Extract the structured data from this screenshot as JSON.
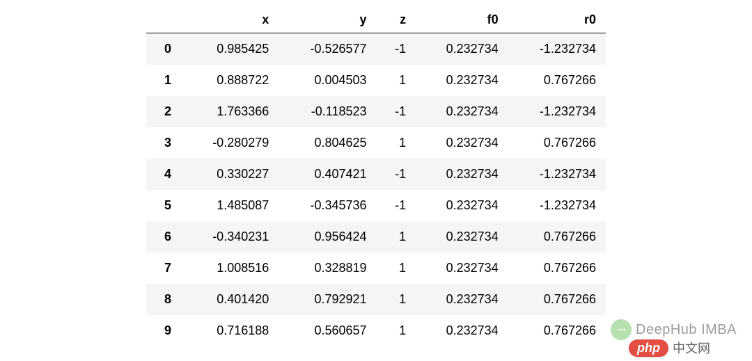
{
  "chart_data": {
    "type": "table",
    "columns": [
      "x",
      "y",
      "z",
      "f0",
      "r0"
    ],
    "index": [
      "0",
      "1",
      "2",
      "3",
      "4",
      "5",
      "6",
      "7",
      "8",
      "9"
    ],
    "rows": [
      {
        "x": "0.985425",
        "y": "-0.526577",
        "z": "-1",
        "f0": "0.232734",
        "r0": "-1.232734"
      },
      {
        "x": "0.888722",
        "y": "0.004503",
        "z": "1",
        "f0": "0.232734",
        "r0": "0.767266"
      },
      {
        "x": "1.763366",
        "y": "-0.118523",
        "z": "-1",
        "f0": "0.232734",
        "r0": "-1.232734"
      },
      {
        "x": "-0.280279",
        "y": "0.804625",
        "z": "1",
        "f0": "0.232734",
        "r0": "0.767266"
      },
      {
        "x": "0.330227",
        "y": "0.407421",
        "z": "-1",
        "f0": "0.232734",
        "r0": "-1.232734"
      },
      {
        "x": "1.485087",
        "y": "-0.345736",
        "z": "-1",
        "f0": "0.232734",
        "r0": "-1.232734"
      },
      {
        "x": "-0.340231",
        "y": "0.956424",
        "z": "1",
        "f0": "0.232734",
        "r0": "0.767266"
      },
      {
        "x": "1.008516",
        "y": "0.328819",
        "z": "1",
        "f0": "0.232734",
        "r0": "0.767266"
      },
      {
        "x": "0.401420",
        "y": "0.792921",
        "z": "1",
        "f0": "0.232734",
        "r0": "0.767266"
      },
      {
        "x": "0.716188",
        "y": "0.560657",
        "z": "1",
        "f0": "0.232734",
        "r0": "0.767266"
      }
    ]
  },
  "watermark": {
    "brand": "DeepHub IMBA",
    "icon": "…"
  },
  "badge": {
    "pill": "php",
    "suffix": "中文网"
  }
}
